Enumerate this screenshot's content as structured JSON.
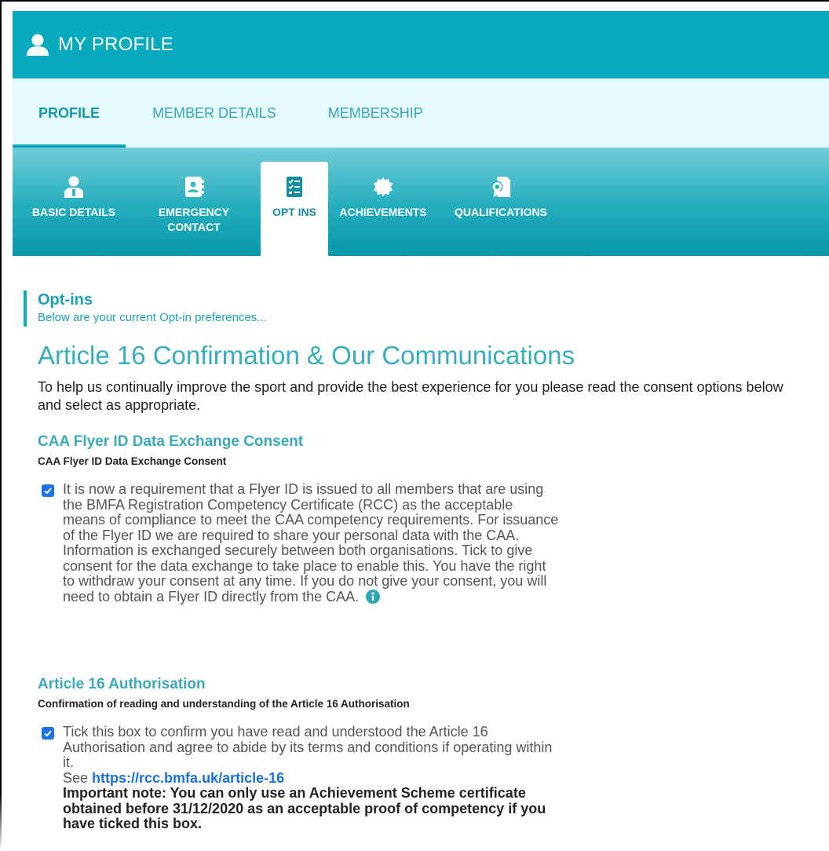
{
  "header": {
    "title": "MY PROFILE",
    "icon": "user-icon"
  },
  "main_tabs": [
    {
      "label": "PROFILE",
      "active": true
    },
    {
      "label": "MEMBER DETAILS",
      "active": false
    },
    {
      "label": "MEMBERSHIP",
      "active": false
    }
  ],
  "sub_tabs": [
    {
      "label": "BASIC DETAILS",
      "icon": "person-badge-icon"
    },
    {
      "label": "EMERGENCY CONTACT",
      "line1": "EMERGENCY",
      "line2": "CONTACT",
      "icon": "contact-book-icon"
    },
    {
      "label": "OPT INS",
      "icon": "checklist-icon",
      "active": true
    },
    {
      "label": "ACHIEVEMENTS",
      "icon": "seal-badge-icon"
    },
    {
      "label": "QUALIFICATIONS",
      "icon": "certificate-icon"
    }
  ],
  "section": {
    "title": "Opt-ins",
    "subtitle": "Below are your current Opt-in preferences..."
  },
  "article": {
    "title": "Article 16 Confirmation & Our Communications",
    "intro": "To help us continually improve the sport and provide the best experience for you please read the consent options below and select as appropriate."
  },
  "consents": [
    {
      "title": "CAA Flyer ID Data Exchange Consent",
      "subtitle": "CAA Flyer ID Data Exchange Consent",
      "checked": true,
      "text": "It is now a requirement that a Flyer ID is issued to all members that are using the BMFA Registration Competency Certificate (RCC) as the acceptable means of compliance to meet the CAA competency requirements. For issuance of the Flyer ID we are required to share your personal data with the CAA. Information is exchanged securely between both organisations. Tick to give consent for the data exchange to take place to enable this. You have the right to withdraw your consent at any time. If you do not give your consent, you will need to obtain a Flyer ID directly from the CAA."
    },
    {
      "title": "Article 16 Authorisation",
      "subtitle": "Confirmation of reading and understanding of the Article 16 Authorisation",
      "checked": true,
      "text": "Tick this box to confirm you have read and understood the Article 16 Authorisation and agree to abide by its terms and conditions if operating within it.",
      "see_prefix": "See",
      "link": "https://rcc.bmfa.uk/article-16",
      "note": "Important note: You can only use an Achievement Scheme certificate obtained before 31/12/2020 as an acceptable proof of competency if you have ticked this box."
    }
  ],
  "colors": {
    "header": "#07abbd",
    "tab_bar": "#e4fafc",
    "accent": "#1aa3b4",
    "checkbox": "#1a73e8"
  }
}
